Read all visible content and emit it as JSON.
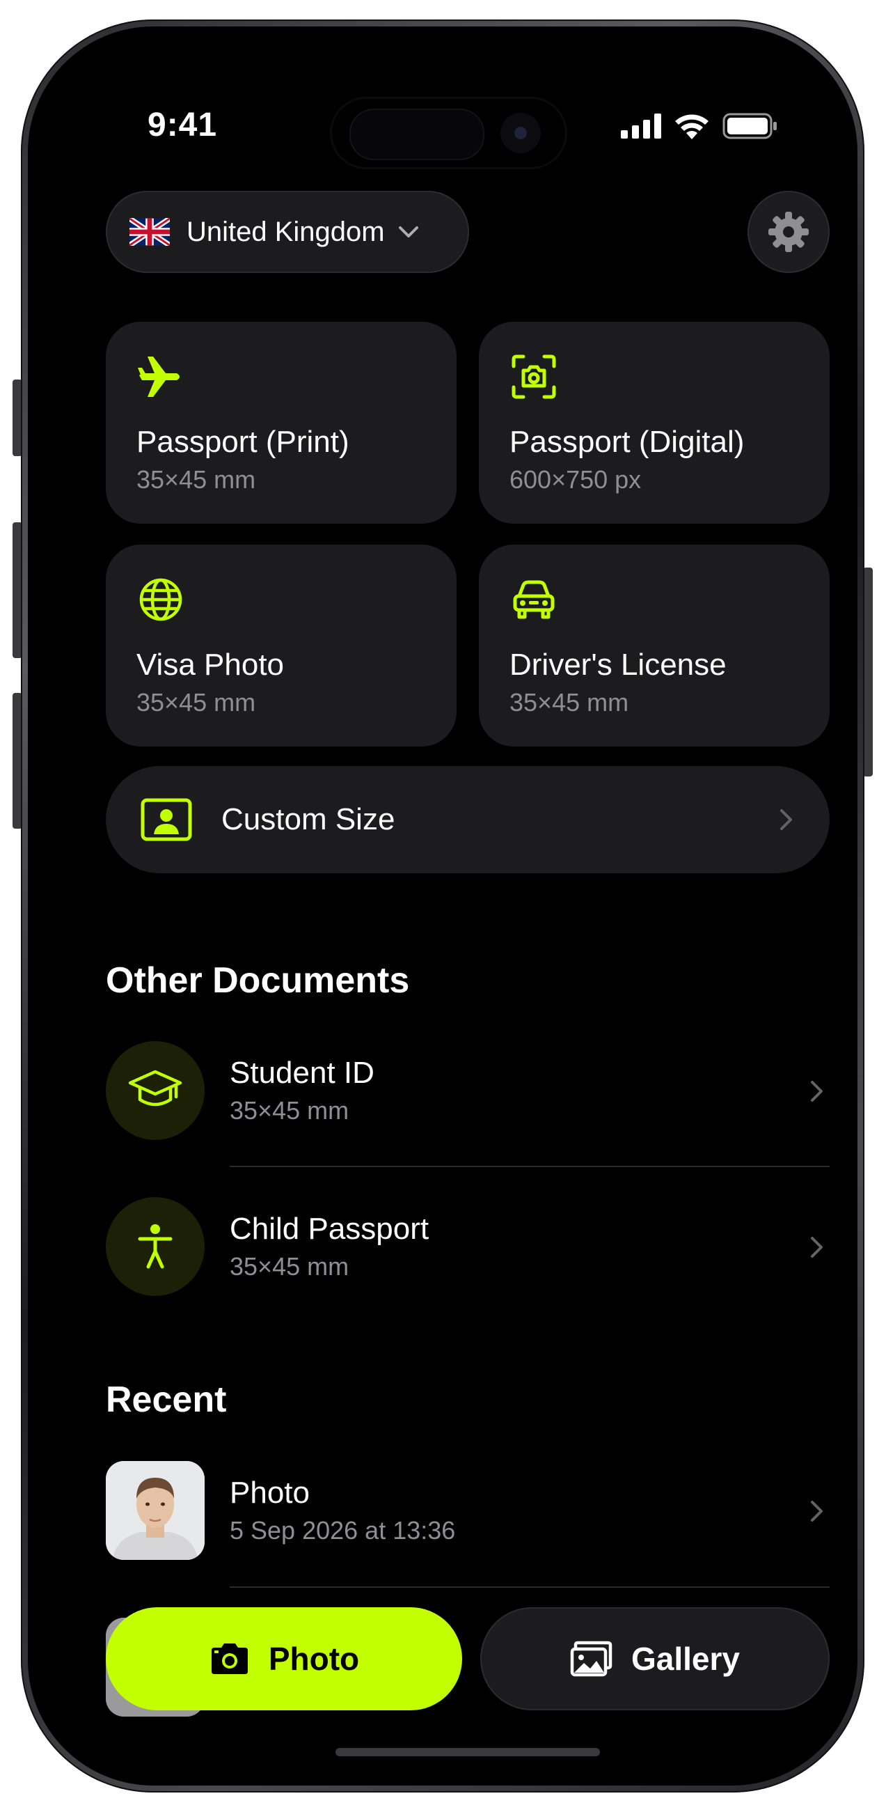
{
  "status_bar": {
    "time": "9:41"
  },
  "country_selector": {
    "label": "United Kingdom"
  },
  "cards": [
    {
      "title": "Passport (Print)",
      "size": "35×45 mm",
      "icon": "airplane-icon"
    },
    {
      "title": "Passport (Digital)",
      "size": "600×750 px",
      "icon": "camera-scan-icon"
    },
    {
      "title": "Visa Photo",
      "size": "35×45 mm",
      "icon": "globe-icon"
    },
    {
      "title": "Driver's License",
      "size": "35×45 mm",
      "icon": "car-icon"
    }
  ],
  "custom_size": {
    "label": "Custom Size",
    "icon": "portrait-frame-icon"
  },
  "other_documents": {
    "heading": "Other Documents",
    "items": [
      {
        "title": "Student ID",
        "size": "35×45 mm",
        "icon": "graduation-cap-icon"
      },
      {
        "title": "Child Passport",
        "size": "35×45 mm",
        "icon": "person-icon"
      }
    ]
  },
  "recent": {
    "heading": "Recent",
    "items": [
      {
        "title": "Photo",
        "date": "5 Sep 2026 at 13:36"
      }
    ]
  },
  "actions": {
    "photo_label": "Photo",
    "gallery_label": "Gallery"
  },
  "colors": {
    "accent": "#c2ff00",
    "background": "#000000",
    "card": "#1c1c1e",
    "secondary_text": "#8e8e93"
  }
}
